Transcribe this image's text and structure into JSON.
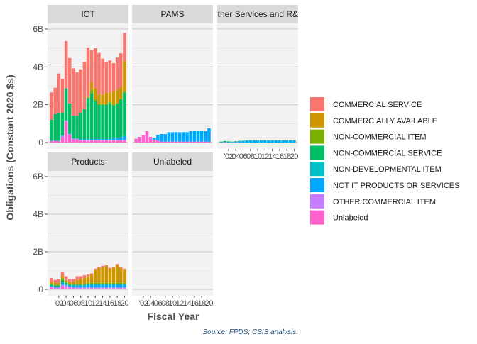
{
  "chart_data": {
    "type": "bar",
    "stacked": true,
    "facet": "wrap",
    "ylabel": "Obligations (Constant 2020 $s)",
    "xlabel": "Fiscal Year",
    "caption": "Source: FPDS; CSIS analysis.",
    "y_ticks": [
      "0",
      "2B",
      "4B",
      "6B"
    ],
    "y_tick_values": [
      0,
      2,
      4,
      6
    ],
    "ylim": [
      0,
      6.3
    ],
    "x_tick_labels": [
      "'02",
      "04",
      "06",
      "08",
      "10",
      "12",
      "14",
      "16",
      "18",
      "20"
    ],
    "years": [
      2000,
      2001,
      2002,
      2003,
      2004,
      2005,
      2006,
      2007,
      2008,
      2009,
      2010,
      2011,
      2012,
      2013,
      2014,
      2015,
      2016,
      2017,
      2018,
      2019,
      2020
    ],
    "legend": {
      "position": "right",
      "entries": [
        {
          "name": "COMMERCIAL SERVICE",
          "color": "#F8766D"
        },
        {
          "name": "COMMERCIALLY AVAILABLE",
          "color": "#CD9600"
        },
        {
          "name": "NON-COMMERCIAL ITEM",
          "color": "#7CAE00"
        },
        {
          "name": "NON-COMMERCIAL SERVICE",
          "color": "#00BE67"
        },
        {
          "name": "NON-DEVELOPMENTAL ITEM",
          "color": "#00BFC4"
        },
        {
          "name": "NOT IT PRODUCTS OR SERVICES",
          "color": "#00A9FF"
        },
        {
          "name": "OTHER COMMERCIAL ITEM",
          "color": "#C77CFF"
        },
        {
          "name": "Unlabeled",
          "color": "#FF61CC"
        }
      ]
    },
    "panels": [
      {
        "title": "ICT",
        "stack_order": [
          "COMMERCIAL SERVICE",
          "COMMERCIALLY AVAILABLE",
          "NON-COMMERCIAL ITEM",
          "NON-COMMERCIAL SERVICE",
          "NON-DEVELOPMENTAL ITEM",
          "NOT IT PRODUCTS OR SERVICES",
          "OTHER COMMERCIAL ITEM",
          "Unlabeled"
        ],
        "series": [
          {
            "name": "COMMERCIAL SERVICE",
            "values": [
              1.45,
              1.4,
              2.1,
              1.8,
              2.5,
              2.4,
              2.5,
              2.3,
              2.3,
              2.5,
              2.6,
              1.7,
              2.1,
              2.2,
              1.9,
              1.6,
              1.7,
              1.5,
              1.7,
              1.8,
              1.5
            ]
          },
          {
            "name": "COMMERCIALLY AVAILABLE",
            "values": [
              0,
              0,
              0,
              0,
              0,
              0,
              0,
              0,
              0,
              0,
              0.05,
              0.4,
              0.6,
              0.5,
              0.5,
              0.6,
              0.5,
              0.7,
              0.7,
              0.6,
              1.6
            ]
          },
          {
            "name": "NON-COMMERCIAL ITEM",
            "values": [
              0,
              0,
              0,
              0,
              0,
              0,
              0,
              0,
              0,
              0,
              0,
              0.2,
              0.1,
              0.05,
              0.05,
              0.05,
              0.05,
              0.05,
              0.05,
              0.05,
              0.05
            ]
          },
          {
            "name": "NON-COMMERCIAL SERVICE",
            "values": [
              1.1,
              1.4,
              1.45,
              1.2,
              1.7,
              1.6,
              1.2,
              1.2,
              1.4,
              1.6,
              2.2,
              2.4,
              2.0,
              1.8,
              1.8,
              1.8,
              1.9,
              1.7,
              1.8,
              2.0,
              2.3
            ]
          },
          {
            "name": "NON-DEVELOPMENTAL ITEM",
            "values": [
              0,
              0,
              0,
              0,
              0,
              0,
              0,
              0,
              0,
              0,
              0,
              0,
              0,
              0,
              0,
              0,
              0,
              0,
              0,
              0,
              0
            ]
          },
          {
            "name": "NOT IT PRODUCTS OR SERVICES",
            "values": [
              0.02,
              0.02,
              0.02,
              0.02,
              0.02,
              0.02,
              0.02,
              0.02,
              0.02,
              0.02,
              0.02,
              0.04,
              0.04,
              0.04,
              0.04,
              0.04,
              0.04,
              0.1,
              0.1,
              0.12,
              0.2
            ]
          },
          {
            "name": "OTHER COMMERCIAL ITEM",
            "values": [
              0,
              0,
              0,
              0.1,
              0.05,
              0.05,
              0.05,
              0.05,
              0.05,
              0.05,
              0.05,
              0.05,
              0.05,
              0.05,
              0.05,
              0.05,
              0.05,
              0.05,
              0.05,
              0.05,
              0.05
            ]
          },
          {
            "name": "Unlabeled",
            "values": [
              0.08,
              0.08,
              0.08,
              0.25,
              1.1,
              0.4,
              0.15,
              0.15,
              0.1,
              0.1,
              0.1,
              0.1,
              0.1,
              0.1,
              0.1,
              0.1,
              0.1,
              0.1,
              0.1,
              0.1,
              0.1
            ]
          }
        ]
      },
      {
        "title": "PAMS",
        "stack_order": [
          "COMMERCIAL SERVICE",
          "COMMERCIALLY AVAILABLE",
          "NON-COMMERCIAL ITEM",
          "NON-COMMERCIAL SERVICE",
          "NON-DEVELOPMENTAL ITEM",
          "NOT IT PRODUCTS OR SERVICES",
          "OTHER COMMERCIAL ITEM",
          "Unlabeled"
        ],
        "series": [
          {
            "name": "COMMERCIAL SERVICE",
            "values": [
              0,
              0,
              0,
              0,
              0,
              0,
              0,
              0,
              0,
              0,
              0,
              0,
              0,
              0,
              0,
              0,
              0,
              0,
              0,
              0,
              0
            ]
          },
          {
            "name": "COMMERCIALLY AVAILABLE",
            "values": [
              0,
              0,
              0,
              0,
              0,
              0,
              0,
              0,
              0,
              0,
              0,
              0,
              0,
              0,
              0,
              0,
              0,
              0,
              0,
              0,
              0
            ]
          },
          {
            "name": "NON-COMMERCIAL ITEM",
            "values": [
              0,
              0,
              0,
              0,
              0,
              0,
              0,
              0,
              0,
              0,
              0,
              0,
              0,
              0,
              0,
              0,
              0,
              0,
              0,
              0,
              0
            ]
          },
          {
            "name": "NON-COMMERCIAL SERVICE",
            "values": [
              0,
              0,
              0,
              0,
              0,
              0,
              0,
              0,
              0,
              0,
              0,
              0,
              0,
              0,
              0,
              0,
              0,
              0,
              0,
              0,
              0
            ]
          },
          {
            "name": "NON-DEVELOPMENTAL ITEM",
            "values": [
              0,
              0,
              0,
              0,
              0,
              0,
              0,
              0,
              0,
              0,
              0,
              0,
              0,
              0,
              0,
              0,
              0,
              0,
              0,
              0,
              0
            ]
          },
          {
            "name": "NOT IT PRODUCTS OR SERVICES",
            "values": [
              0,
              0,
              0,
              0,
              0,
              0.1,
              0.3,
              0.4,
              0.4,
              0.5,
              0.5,
              0.5,
              0.5,
              0.5,
              0.5,
              0.55,
              0.55,
              0.55,
              0.55,
              0.55,
              0.7
            ]
          },
          {
            "name": "OTHER COMMERCIAL ITEM",
            "values": [
              0,
              0,
              0,
              0,
              0,
              0,
              0,
              0,
              0,
              0,
              0,
              0,
              0,
              0,
              0,
              0,
              0,
              0,
              0,
              0,
              0
            ]
          },
          {
            "name": "Unlabeled",
            "values": [
              0.2,
              0.3,
              0.4,
              0.6,
              0.3,
              0.15,
              0.1,
              0.05,
              0.05,
              0.05,
              0.05,
              0.05,
              0.05,
              0.05,
              0.05,
              0.05,
              0.05,
              0.05,
              0.05,
              0.05,
              0.05
            ]
          }
        ]
      },
      {
        "title": "Other Services and R&D",
        "stack_order": [
          "COMMERCIAL SERVICE",
          "COMMERCIALLY AVAILABLE",
          "NON-COMMERCIAL ITEM",
          "NON-COMMERCIAL SERVICE",
          "NON-DEVELOPMENTAL ITEM",
          "NOT IT PRODUCTS OR SERVICES",
          "OTHER COMMERCIAL ITEM",
          "Unlabeled"
        ],
        "series": [
          {
            "name": "COMMERCIAL SERVICE",
            "values": [
              0,
              0,
              0,
              0,
              0,
              0,
              0,
              0,
              0,
              0,
              0,
              0,
              0,
              0,
              0,
              0,
              0,
              0,
              0,
              0,
              0
            ]
          },
          {
            "name": "COMMERCIALLY AVAILABLE",
            "values": [
              0,
              0,
              0,
              0,
              0,
              0,
              0,
              0,
              0,
              0,
              0,
              0,
              0,
              0,
              0,
              0,
              0,
              0,
              0,
              0,
              0
            ]
          },
          {
            "name": "NON-COMMERCIAL ITEM",
            "values": [
              0,
              0,
              0,
              0,
              0,
              0,
              0,
              0,
              0,
              0,
              0,
              0,
              0,
              0,
              0,
              0,
              0,
              0,
              0,
              0,
              0
            ]
          },
          {
            "name": "NON-COMMERCIAL SERVICE",
            "values": [
              0.03,
              0.05,
              0.04,
              0.02,
              0.02,
              0.02,
              0.02,
              0.02,
              0.02,
              0.02,
              0.02,
              0.02,
              0.02,
              0.02,
              0.02,
              0.02,
              0.02,
              0.02,
              0.02,
              0.02,
              0.02
            ]
          },
          {
            "name": "NON-DEVELOPMENTAL ITEM",
            "values": [
              0,
              0,
              0,
              0,
              0,
              0,
              0,
              0,
              0,
              0,
              0,
              0,
              0,
              0,
              0,
              0,
              0,
              0,
              0,
              0,
              0
            ]
          },
          {
            "name": "NOT IT PRODUCTS OR SERVICES",
            "values": [
              0.01,
              0.02,
              0.01,
              0.02,
              0.04,
              0.06,
              0.08,
              0.09,
              0.1,
              0.1,
              0.1,
              0.1,
              0.1,
              0.1,
              0.1,
              0.1,
              0.1,
              0.1,
              0.1,
              0.1,
              0.1
            ]
          },
          {
            "name": "OTHER COMMERCIAL ITEM",
            "values": [
              0,
              0,
              0,
              0,
              0,
              0,
              0,
              0,
              0,
              0,
              0,
              0,
              0,
              0,
              0,
              0,
              0,
              0,
              0,
              0,
              0
            ]
          },
          {
            "name": "Unlabeled",
            "values": [
              0.01,
              0.01,
              0.01,
              0.01,
              0.01,
              0.01,
              0,
              0,
              0,
              0,
              0,
              0,
              0,
              0,
              0,
              0,
              0,
              0,
              0,
              0,
              0
            ]
          }
        ]
      },
      {
        "title": "Products",
        "stack_order": [
          "COMMERCIAL SERVICE",
          "COMMERCIALLY AVAILABLE",
          "NON-COMMERCIAL ITEM",
          "NON-COMMERCIAL SERVICE",
          "NON-DEVELOPMENTAL ITEM",
          "NOT IT PRODUCTS OR SERVICES",
          "OTHER COMMERCIAL ITEM",
          "Unlabeled"
        ],
        "series": [
          {
            "name": "COMMERCIAL SERVICE",
            "values": [
              0.2,
              0.15,
              0.2,
              0.2,
              0.2,
              0.15,
              0.15,
              0.2,
              0.15,
              0.15,
              0.1,
              0.05,
              0.05,
              0.05,
              0.05,
              0.05,
              0.05,
              0.05,
              0.05,
              0.05,
              0.05
            ]
          },
          {
            "name": "COMMERCIALLY AVAILABLE",
            "values": [
              0.1,
              0.1,
              0.1,
              0.1,
              0.1,
              0.1,
              0.1,
              0.2,
              0.25,
              0.3,
              0.35,
              0.45,
              0.7,
              0.8,
              0.85,
              0.9,
              0.75,
              0.8,
              0.95,
              0.8,
              0.7
            ]
          },
          {
            "name": "NON-COMMERCIAL ITEM",
            "values": [
              0.05,
              0.05,
              0.05,
              0.1,
              0.05,
              0.05,
              0.05,
              0.05,
              0.05,
              0.05,
              0.05,
              0.05,
              0.05,
              0.05,
              0.05,
              0.05,
              0.05,
              0.05,
              0.05,
              0.05,
              0.05
            ]
          },
          {
            "name": "NON-COMMERCIAL SERVICE",
            "values": [
              0.05,
              0.05,
              0.05,
              0.15,
              0.1,
              0.05,
              0.05,
              0.05,
              0.05,
              0.05,
              0.05,
              0.05,
              0.05,
              0.05,
              0.05,
              0.05,
              0.05,
              0.05,
              0.05,
              0.05,
              0.05
            ]
          },
          {
            "name": "NON-DEVELOPMENTAL ITEM",
            "values": [
              0,
              0,
              0,
              0,
              0,
              0,
              0,
              0,
              0,
              0,
              0,
              0,
              0,
              0,
              0,
              0,
              0,
              0,
              0,
              0,
              0
            ]
          },
          {
            "name": "NOT IT PRODUCTS OR SERVICES",
            "values": [
              0.05,
              0.05,
              0.05,
              0.1,
              0.05,
              0.05,
              0.1,
              0.1,
              0.1,
              0.1,
              0.15,
              0.15,
              0.15,
              0.15,
              0.15,
              0.15,
              0.15,
              0.15,
              0.15,
              0.15,
              0.15
            ]
          },
          {
            "name": "OTHER COMMERCIAL ITEM",
            "values": [
              0.05,
              0.05,
              0.05,
              0.1,
              0.1,
              0.1,
              0.05,
              0.05,
              0.05,
              0.05,
              0.05,
              0.05,
              0.05,
              0.05,
              0.05,
              0.05,
              0.05,
              0.05,
              0.05,
              0.05,
              0.05
            ]
          },
          {
            "name": "Unlabeled",
            "values": [
              0.1,
              0.05,
              0.05,
              0.15,
              0.1,
              0.05,
              0.05,
              0.05,
              0.05,
              0.05,
              0.05,
              0.05,
              0.05,
              0.05,
              0.05,
              0.05,
              0.05,
              0.05,
              0.05,
              0.05,
              0.05
            ]
          }
        ]
      },
      {
        "title": "Unlabeled",
        "stack_order": [],
        "series": []
      }
    ]
  }
}
